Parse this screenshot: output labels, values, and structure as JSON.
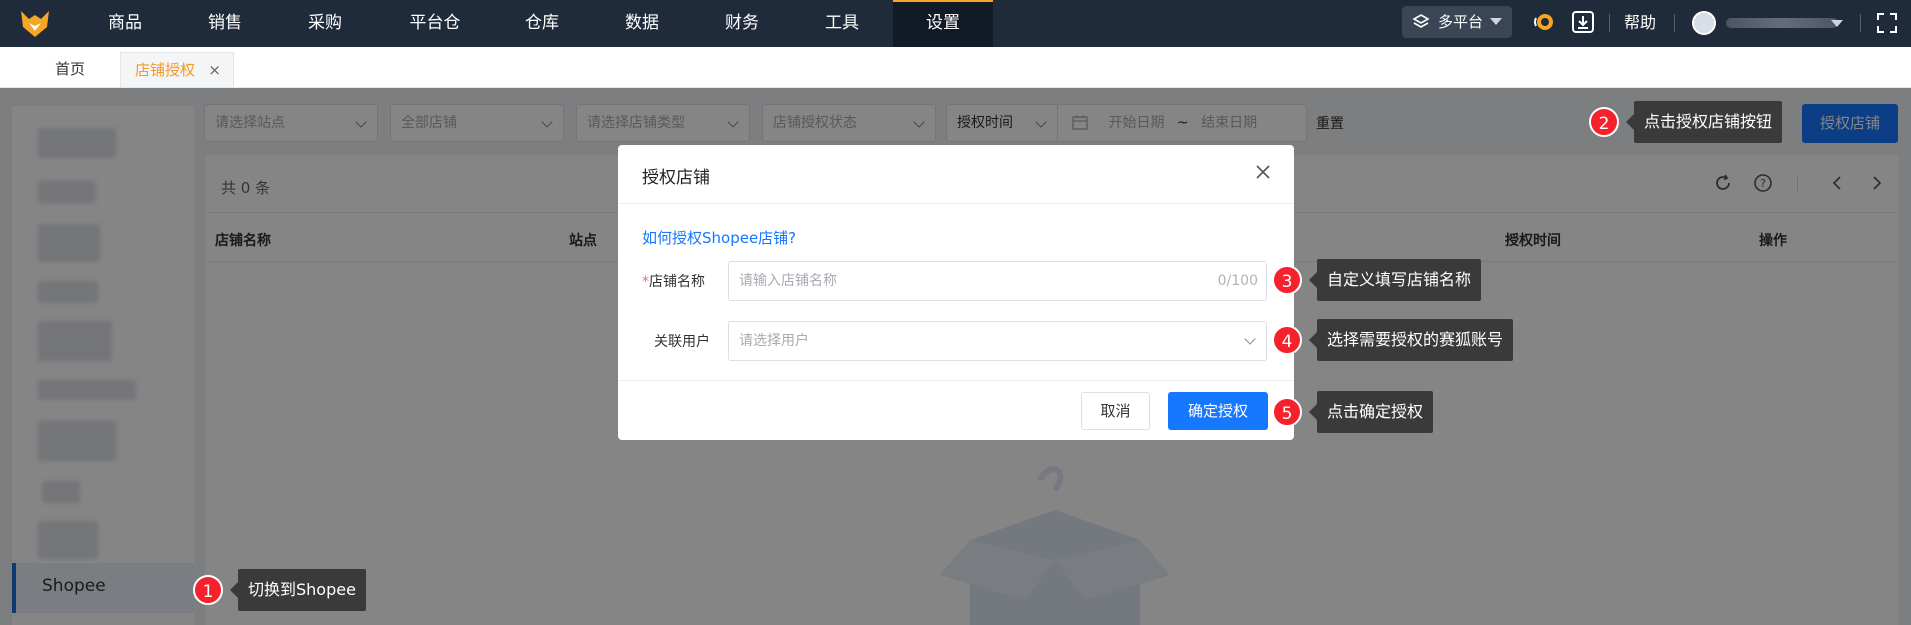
{
  "topnav": {
    "items": [
      "商品",
      "销售",
      "采购",
      "平台仓",
      "仓库",
      "数据",
      "财务",
      "工具",
      "设置"
    ],
    "active_index": 8,
    "platform_label": "多平台",
    "help_label": "帮助",
    "accent_color": "#f5a623"
  },
  "tabbar": {
    "home": "首页",
    "current": "店铺授权",
    "close": "×"
  },
  "sidebar": {
    "active_item": "Shopee"
  },
  "filters": {
    "site": "请选择站点",
    "shop": "全部店铺",
    "shop_type": "请选择店铺类型",
    "auth_status": "店铺授权状态",
    "time_type": "授权时间",
    "start_date": "开始日期",
    "range_sep": "~",
    "end_date": "结束日期",
    "reset": "重置",
    "authorize_button": "授权店铺"
  },
  "table": {
    "total": "共 0 条",
    "columns": [
      "店铺名称",
      "站点",
      "授权时间",
      "操作"
    ]
  },
  "modal": {
    "title": "授权店铺",
    "help_link": "如何授权Shopee店铺?",
    "shop_name_required": "*",
    "shop_name_label": "店铺名称",
    "shop_name_placeholder": "请输入店铺名称",
    "shop_name_counter": "0/100",
    "user_label": "关联用户",
    "user_placeholder": "请选择用户",
    "cancel": "取消",
    "confirm": "确定授权"
  },
  "callouts": [
    {
      "num": "1",
      "text": "切换到Shopee"
    },
    {
      "num": "2",
      "text": "点击授权店铺按钮"
    },
    {
      "num": "3",
      "text": "自定义填写店铺名称"
    },
    {
      "num": "4",
      "text": "选择需要授权的赛狐账号"
    },
    {
      "num": "5",
      "text": "点击确定授权"
    }
  ],
  "colors": {
    "primary": "#1677ff",
    "nav_bg": "#1f2a3a",
    "badge": "#f5222d",
    "callout_bg": "#3a3a3a"
  }
}
